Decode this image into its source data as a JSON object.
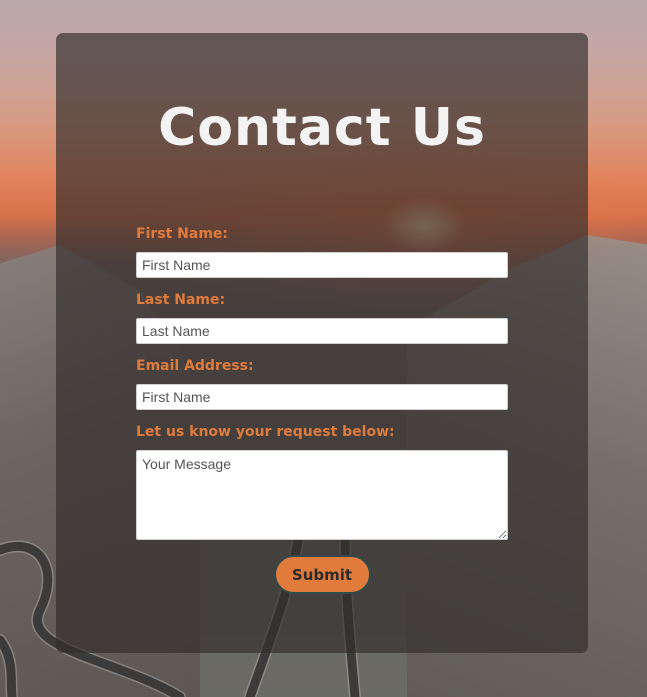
{
  "page": {
    "title": "Contact Us"
  },
  "form": {
    "first_name": {
      "label": "First Name:",
      "placeholder": "First Name",
      "value": ""
    },
    "last_name": {
      "label": "Last Name:",
      "placeholder": "Last Name",
      "value": ""
    },
    "email": {
      "label": "Email Address:",
      "placeholder": "First Name",
      "value": ""
    },
    "message": {
      "label": "Let us know your request below:",
      "placeholder": "Your Message",
      "value": ""
    },
    "submit_label": "Submit"
  },
  "colors": {
    "accent": "#e07b3c",
    "title": "#f3f3f3",
    "card_overlay": "#302c2a",
    "button_border": "#2e4a4a"
  }
}
